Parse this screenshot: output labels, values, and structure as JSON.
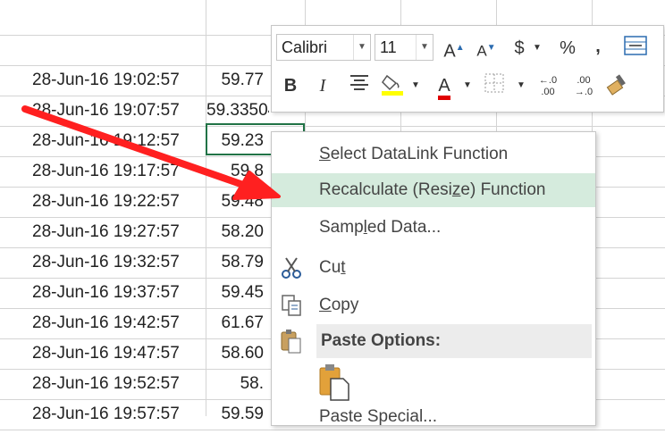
{
  "sheet": {
    "rows": [
      {
        "time": "28-Jun-16 19:02:57",
        "value": "59.77"
      },
      {
        "time": "28-Jun-16 19:07:57",
        "value": "59.33504"
      },
      {
        "time": "28-Jun-16 19:12:57",
        "value": "59.23"
      },
      {
        "time": "28-Jun-16 19:17:57",
        "value": "59.8"
      },
      {
        "time": "28-Jun-16 19:22:57",
        "value": "59.48"
      },
      {
        "time": "28-Jun-16 19:27:57",
        "value": "58.20"
      },
      {
        "time": "28-Jun-16 19:32:57",
        "value": "58.79"
      },
      {
        "time": "28-Jun-16 19:37:57",
        "value": "59.45"
      },
      {
        "time": "28-Jun-16 19:42:57",
        "value": "61.67"
      },
      {
        "time": "28-Jun-16 19:47:57",
        "value": "58.60"
      },
      {
        "time": "28-Jun-16 19:52:57",
        "value": "58."
      },
      {
        "time": "28-Jun-16 19:57:57",
        "value": "59.59"
      }
    ]
  },
  "toolbar": {
    "font_name": "Calibri",
    "font_size": "11",
    "increase_font": "A",
    "decrease_font": "A",
    "currency": "$",
    "percent": "%",
    "comma": ",",
    "bold": "B",
    "italic": "I",
    "font_color_letter": "A",
    "inc_decimal": "←.0 .00",
    "dec_decimal": ".00 →.0",
    "fill_color": "#ffff00",
    "font_color": "#e00000"
  },
  "menu": {
    "select_datalink": {
      "pre": "",
      "ul": "S",
      "post": "elect DataLink Function"
    },
    "recalculate": {
      "pre": "Recalculate (Resi",
      "ul": "z",
      "post": "e) Function"
    },
    "sampled_data": {
      "pre": "Samp",
      "ul": "l",
      "post": "ed Data..."
    },
    "cut": {
      "pre": "Cu",
      "ul": "t",
      "post": ""
    },
    "copy": {
      "pre": "",
      "ul": "C",
      "post": "opy"
    },
    "paste_options": "Paste Options:",
    "paste_special": "Paste Special..."
  },
  "colors": {
    "accent": "#217346",
    "highlight": "#d5ebdd",
    "arrow": "#ff2020"
  }
}
